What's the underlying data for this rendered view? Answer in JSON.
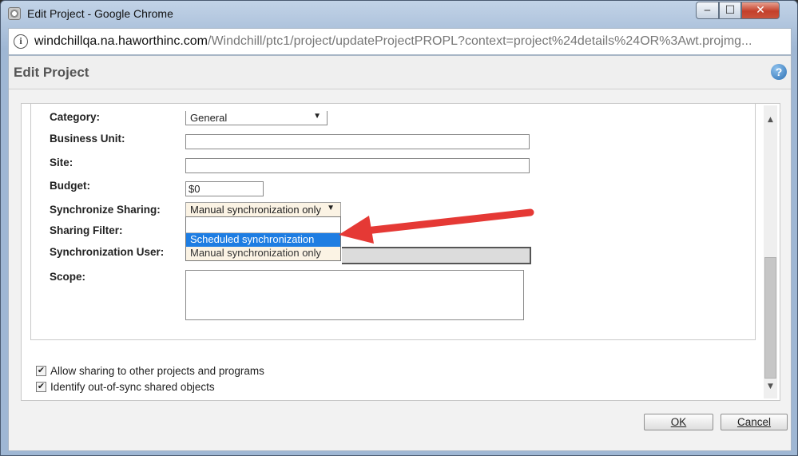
{
  "window": {
    "title": "Edit Project - Google Chrome",
    "minimize": "‒",
    "maximize": "☐",
    "close": "✕"
  },
  "address_bar": {
    "host": "windchillqa.na.haworthinc.com",
    "path": "/Windchill/ptc1/project/updateProjectPROPL?context=project%24details%24OR%3Awt.projmg..."
  },
  "page": {
    "title": "Edit Project",
    "help_icon": "?"
  },
  "form": {
    "category": {
      "label": "Category:",
      "value": "General"
    },
    "business_unit": {
      "label": "Business Unit:",
      "value": ""
    },
    "site": {
      "label": "Site:",
      "value": ""
    },
    "budget": {
      "label": "Budget:",
      "value": "$0"
    },
    "synchronize_sharing": {
      "label": "Synchronize Sharing:",
      "value": "Manual synchronization only",
      "options": [
        "",
        "Scheduled synchronization",
        "Manual synchronization only"
      ]
    },
    "sharing_filter": {
      "label": "Sharing Filter:"
    },
    "synchronization_user": {
      "label": "Synchronization User:"
    },
    "scope": {
      "label": "Scope:",
      "value": ""
    }
  },
  "options": {
    "allow_sharing": {
      "label": "Allow sharing to other projects and programs",
      "checked": true
    },
    "identify_out_of_sync": {
      "label": "Identify out-of-sync shared objects",
      "checked": true
    }
  },
  "buttons": {
    "ok": "OK",
    "cancel": "Cancel"
  },
  "colors": {
    "highlight": "#1e7de2",
    "annotation_arrow": "#e53935"
  }
}
